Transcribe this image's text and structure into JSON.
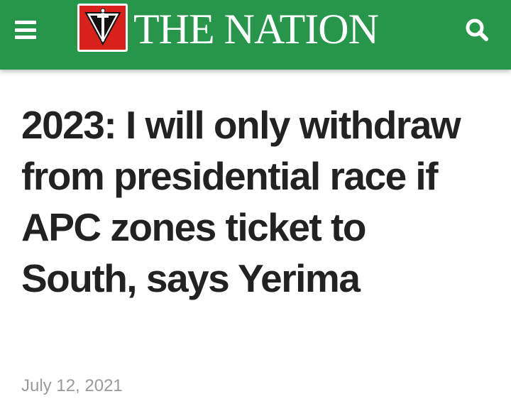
{
  "header": {
    "site_name": "THE NATION",
    "menu_icon": "hamburger-menu-icon",
    "search_icon": "search-icon",
    "logo_emblem_icon": "sword-shield-emblem-icon",
    "colors": {
      "bar": "#27964a",
      "emblem": "#d9221c",
      "text": "#ffffff"
    }
  },
  "article": {
    "headline": "2023: I will only withdraw from presidential race if APC zones ticket to South, says Yerima",
    "date": "July 12, 2021",
    "colors": {
      "headline": "#222222",
      "date": "#9a9a9a"
    }
  }
}
